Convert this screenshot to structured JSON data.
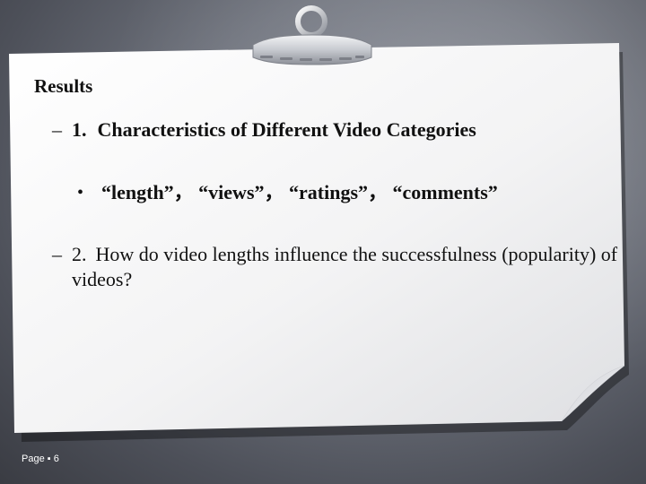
{
  "slide": {
    "title": "Results",
    "items": [
      {
        "marker": "–",
        "number": "1.",
        "text": "Characteristics of Different Video Categories",
        "subitems": [
          {
            "marker": "•",
            "text": "“length”， “views”， “ratings”， “comments”"
          }
        ]
      },
      {
        "marker": "–",
        "number": "2.",
        "text": "How do video lengths influence the successfulness (popularity) of videos?"
      }
    ]
  },
  "footer": {
    "label": "Page",
    "separator": "▪",
    "page_number": "6"
  },
  "colors": {
    "background": "#6f737d",
    "paper": "#f7f7f7",
    "text": "#111111",
    "footer_text": "#ffffff"
  }
}
